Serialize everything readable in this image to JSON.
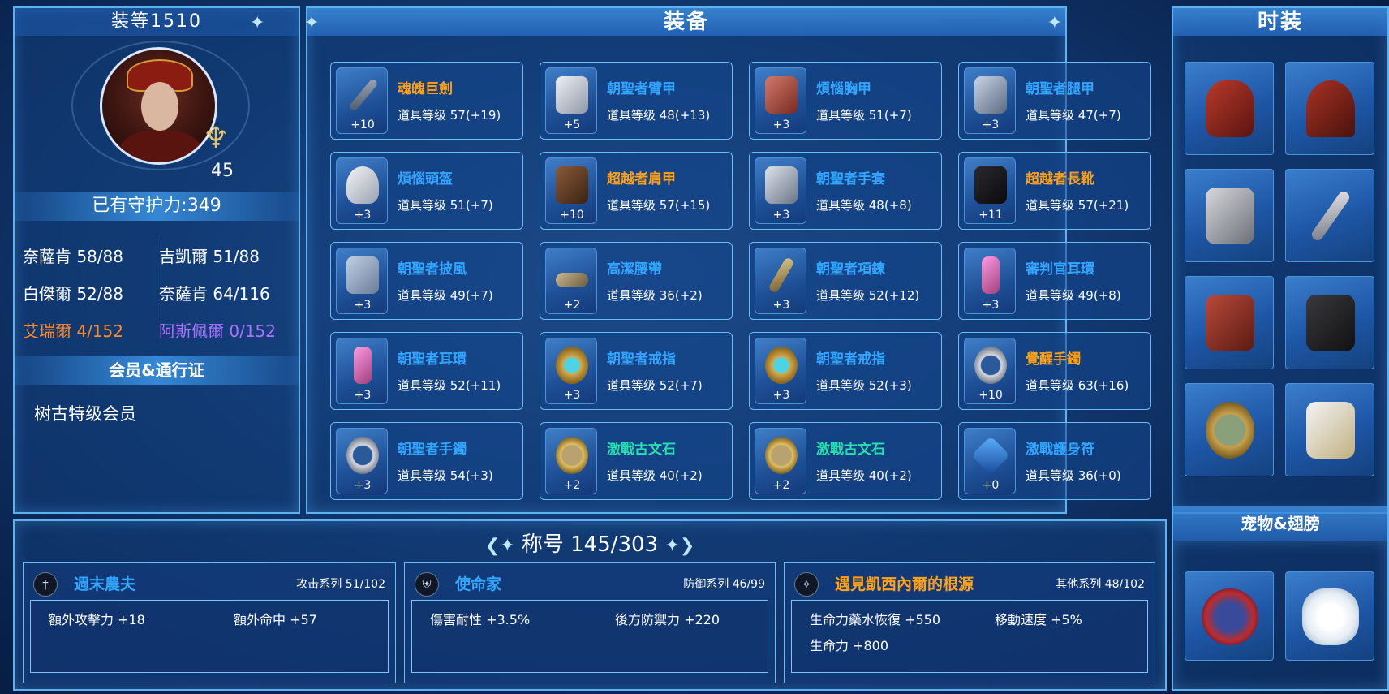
{
  "left": {
    "gear_score": "装等1510",
    "level": "45",
    "guard_power": "已有守护力:349",
    "stats": [
      {
        "text": "奈薩肯 58/88",
        "color": "#ffffff"
      },
      {
        "text": "吉凱爾 51/88",
        "color": "#ffffff"
      },
      {
        "text": "白傑爾 52/88",
        "color": "#ffffff"
      },
      {
        "text": "奈薩肯 64/116",
        "color": "#ffffff"
      },
      {
        "text": "艾瑞爾 4/152",
        "color": "#ff8a2a"
      },
      {
        "text": "阿斯佩爾 0/152",
        "color": "#b070ff"
      }
    ],
    "membership_header": "会员&通行证",
    "membership": "树古特级会员"
  },
  "equip": {
    "title": "装备",
    "items": [
      {
        "name": "魂魄巨劍",
        "level": "道具等级 57(+19)",
        "plus": "+10",
        "color": "orange",
        "icon": "sword-icon"
      },
      {
        "name": "朝聖者臂甲",
        "level": "道具等级 48(+13)",
        "plus": "+5",
        "color": "blue",
        "icon": "armguard-icon"
      },
      {
        "name": "煩惱胸甲",
        "level": "道具等级 51(+7)",
        "plus": "+3",
        "color": "blue",
        "icon": "chest-armor-icon"
      },
      {
        "name": "朝聖者腿甲",
        "level": "道具等级 47(+7)",
        "plus": "+3",
        "color": "blue",
        "icon": "leg-armor-icon"
      },
      {
        "name": "煩惱頭盔",
        "level": "道具等级 51(+7)",
        "plus": "+3",
        "color": "blue",
        "icon": "helmet-icon"
      },
      {
        "name": "超越者肩甲",
        "level": "道具等级 57(+15)",
        "plus": "+10",
        "color": "orange",
        "icon": "shoulder-icon"
      },
      {
        "name": "朝聖者手套",
        "level": "道具等级 48(+8)",
        "plus": "+3",
        "color": "blue",
        "icon": "gloves-icon"
      },
      {
        "name": "超越者長靴",
        "level": "道具等级 57(+21)",
        "plus": "+11",
        "color": "orange",
        "icon": "boots-icon"
      },
      {
        "name": "朝聖者披風",
        "level": "道具等级 49(+7)",
        "plus": "+3",
        "color": "blue",
        "icon": "cloak-icon"
      },
      {
        "name": "高潔腰帶",
        "level": "道具等级 36(+2)",
        "plus": "+2",
        "color": "blue",
        "icon": "belt-icon"
      },
      {
        "name": "朝聖者項鍊",
        "level": "道具等级 52(+12)",
        "plus": "+3",
        "color": "blue",
        "icon": "necklace-icon"
      },
      {
        "name": "審判官耳環",
        "level": "道具等级 49(+8)",
        "plus": "+3",
        "color": "blue",
        "icon": "earring-icon"
      },
      {
        "name": "朝聖者耳環",
        "level": "道具等级 52(+11)",
        "plus": "+3",
        "color": "blue",
        "icon": "earring-icon"
      },
      {
        "name": "朝聖者戒指",
        "level": "道具等级 52(+7)",
        "plus": "+3",
        "color": "blue",
        "icon": "ring-icon"
      },
      {
        "name": "朝聖者戒指",
        "level": "道具等级 52(+3)",
        "plus": "+3",
        "color": "blue",
        "icon": "ring-icon"
      },
      {
        "name": "覺醒手鐲",
        "level": "道具等级 63(+16)",
        "plus": "+10",
        "color": "orange",
        "icon": "bracelet-icon"
      },
      {
        "name": "朝聖者手鐲",
        "level": "道具等级 54(+3)",
        "plus": "+3",
        "color": "blue",
        "icon": "bracelet-icon"
      },
      {
        "name": "激戰古文石",
        "level": "道具等级 40(+2)",
        "plus": "+2",
        "color": "teal",
        "icon": "runestone-icon"
      },
      {
        "name": "激戰古文石",
        "level": "道具等级 40(+2)",
        "plus": "+2",
        "color": "teal",
        "icon": "runestone-icon"
      },
      {
        "name": "激戰護身符",
        "level": "道具等级 36(+0)",
        "plus": "+0",
        "color": "blue",
        "icon": "amulet-icon"
      }
    ]
  },
  "fashion": {
    "title": "时装",
    "slots": [
      "hat-icon",
      "hood-icon",
      "boots-icon",
      "staff-icon",
      "coat-icon",
      "pants-icon",
      "earring-icon",
      "glove-icon"
    ],
    "pet_header": "宠物&翅膀",
    "pets": [
      "pet-icon",
      "wings-icon"
    ]
  },
  "titles": {
    "header": "称号 145/303",
    "cards": [
      {
        "name": "週末農夫",
        "name_color": "#33a6ff",
        "category": "攻击系列 51/102",
        "icon": "sword-emblem-icon",
        "attrs": [
          "額外攻擊力 +18",
          "額外命中 +57"
        ]
      },
      {
        "name": "使命家",
        "name_color": "#33a6ff",
        "category": "防御系列 46/99",
        "icon": "shield-emblem-icon",
        "attrs": [
          "傷害耐性 +3.5%",
          "後方防禦力 +220"
        ]
      },
      {
        "name": "遇見凱西內爾的根源",
        "name_color": "#ffa21a",
        "category": "其他系列 48/102",
        "icon": "star-emblem-icon",
        "attrs": [
          "生命力藥水恢復 +550",
          "移動速度 +5%",
          "生命力 +800"
        ]
      }
    ]
  }
}
